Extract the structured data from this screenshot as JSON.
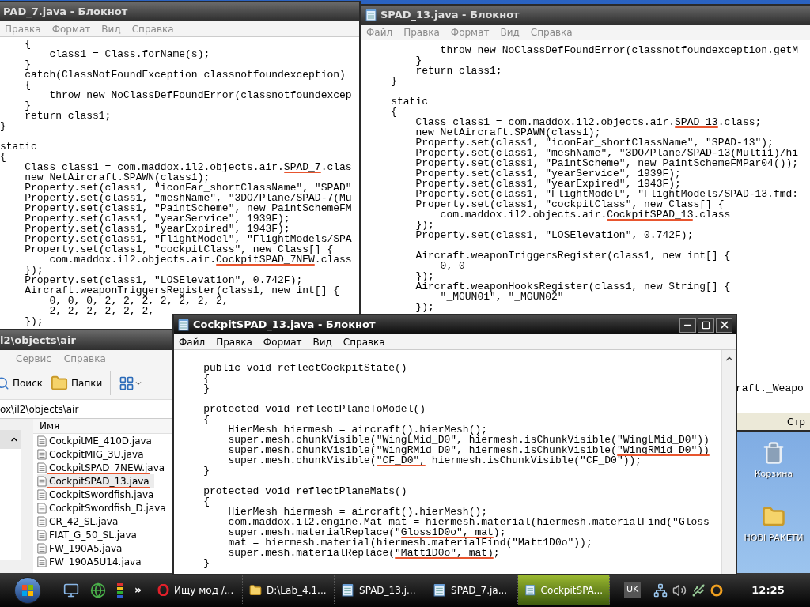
{
  "notepads": [
    {
      "title": "PAD_7.java - Блокнот",
      "active": false,
      "menu": [
        "Правка",
        "Формат",
        "Вид",
        "Справка"
      ],
      "blocks": [
        [
          "    {",
          "        class1 = Class.forName(s);",
          "    }",
          "    catch(ClassNotFoundException classnotfoundexception)",
          "    {",
          "        throw new NoClassDefFoundError(classnotfoundexcep",
          "    }",
          "    return class1;",
          "}"
        ],
        [
          "static",
          "{",
          {
            "parts": [
              {
                "text": "    Class class1 = com.maddox.il2.objects.air.",
                "underlined": false
              },
              {
                "text": "SPAD_7",
                "underlined": true
              },
              {
                "text": ".clas",
                "underlined": false
              }
            ]
          },
          "    new NetAircraft.SPAWN(class1);",
          "    Property.set(class1, \"iconFar_shortClassName\", \"SPAD\"",
          "    Property.set(class1, \"meshName\", \"3DO/Plane/SPAD-7(Mu",
          "    Property.set(class1, \"PaintScheme\", new PaintSchemeFM",
          "    Property.set(class1, \"yearService\", 1939F);",
          "    Property.set(class1, \"yearExpired\", 1943F);",
          "    Property.set(class1, \"FlightModel\", \"FlightModels/SPA",
          "    Property.set(class1, \"cockpitClass\", new Class[] {",
          {
            "parts": [
              {
                "text": "        com.maddox.il2.objects.air.",
                "underlined": false
              },
              {
                "text": "CockpitSPAD_7NEW",
                "underlined": true
              },
              {
                "text": ".class",
                "underlined": false
              }
            ]
          },
          "    });",
          "    Property.set(class1, \"LOSElevation\", 0.742F);",
          "    Aircraft.weaponTriggersRegister(class1, new int[] {",
          "        0, 0, 0, 2, 2, 2, 2, 2, 2, 2,",
          "        2, 2, 2, 2, 2, 2,",
          "    });"
        ]
      ]
    },
    {
      "title": "SPAD_13.java - Блокнот",
      "active": false,
      "menu": [
        "Файл",
        "Правка",
        "Формат",
        "Вид",
        "Справка"
      ],
      "blocks": [
        [
          "            throw new NoClassDefFoundError(classnotfoundexception.getM",
          "        }",
          "        return class1;",
          "    }"
        ],
        [
          "    static",
          "    {",
          {
            "parts": [
              {
                "text": "        Class class1 = com.maddox.il2.objects.air.",
                "underlined": false
              },
              {
                "text": "SPAD_13",
                "underlined": true
              },
              {
                "text": ".class;",
                "underlined": false
              }
            ]
          },
          "        new NetAircraft.SPAWN(class1);",
          "        Property.set(class1, \"iconFar_shortClassName\", \"SPAD-13\");",
          "        Property.set(class1, \"meshName\", \"3DO/Plane/SPAD-13(Multi1)/hi",
          "        Property.set(class1, \"PaintScheme\", new PaintSchemeFMPar04());",
          "        Property.set(class1, \"yearService\", 1939F);",
          "        Property.set(class1, \"yearExpired\", 1943F);",
          "        Property.set(class1, \"FlightModel\", \"FlightModels/SPAD-13.fmd:",
          "        Property.set(class1, \"cockpitClass\", new Class[] {",
          {
            "parts": [
              {
                "text": "            com.maddox.il2.objects.air.",
                "underlined": false
              },
              {
                "text": "CockpitSPAD_13",
                "underlined": true
              },
              {
                "text": ".class",
                "underlined": false
              }
            ]
          },
          "        });",
          "        Property.set(class1, \"LOSElevation\", 0.742F);"
        ],
        [
          "        Aircraft.weaponTriggersRegister(class1, new int[] {",
          "            0, 0",
          "        });",
          "        Aircraft.weaponHooksRegister(class1, new String[] {",
          "            \"_MGUN01\", \"_MGUN02\"",
          "        });"
        ]
      ],
      "fragment": "raft._Weapo",
      "status_text": "Стр"
    },
    {
      "title": "CockpitSPAD_13.java - Блокнот",
      "active": true,
      "window_buttons": true,
      "scrollbar": true,
      "menu": [
        "Файл",
        "Правка",
        "Формат",
        "Вид",
        "Справка"
      ],
      "blocks": [
        [
          "    public void reflectCockpitState()",
          "    {",
          "    }"
        ],
        [
          "    protected void reflectPlaneToModel()",
          "    {",
          "        HierMesh hiermesh = aircraft().hierMesh();",
          "        super.mesh.chunkVisible(\"WingLMid_D0\", hiermesh.isChunkVisible(\"WingLMid_D0\"))",
          {
            "parts": [
              {
                "text": "        super.mesh.chunkVisible(\"WingRMid_D0\", hiermesh.isChunkVisible(",
                "underlined": false
              },
              {
                "text": "\"WingRMid_D0\"))",
                "underlined": true
              }
            ]
          },
          {
            "parts": [
              {
                "text": "        super.mesh.chunkVisible(",
                "underlined": false
              },
              {
                "text": "\"CF_D0\",",
                "underlined": true
              },
              {
                "text": " hiermesh.isChunkVisible(\"CF_D0\"));",
                "underlined": false
              }
            ]
          },
          "    }"
        ],
        [
          "    protected void reflectPlaneMats()",
          "    {",
          "        HierMesh hiermesh = aircraft().hierMesh();",
          "        com.maddox.il2.engine.Mat mat = hiermesh.material(hiermesh.materialFind(\"Gloss",
          {
            "parts": [
              {
                "text": "        super.mesh.materialReplace(\"",
                "underlined": false
              },
              {
                "text": "Gloss1D0o\", mat",
                "underlined": true
              },
              {
                "text": ");",
                "underlined": false
              }
            ]
          },
          "        mat = hiermesh.material(hiermesh.materialFind(\"Matt1D0o\"));",
          {
            "parts": [
              {
                "text": "        super.mesh.materialReplace(",
                "underlined": false
              },
              {
                "text": "\"Matt1D0o\", mat)",
                "underlined": true
              },
              {
                "text": ";",
                "underlined": false
              }
            ]
          },
          "    }"
        ]
      ]
    }
  ],
  "explorer": {
    "title": "l2\\objects\\air",
    "menu": [
      "Сервис",
      "Справка"
    ],
    "toolbar": [
      "Поиск",
      "Папки"
    ],
    "address": "ox\\il2\\objects\\air",
    "column_header": "Имя",
    "files": [
      {
        "name": "CockpitME_410D.java",
        "selected": false,
        "underlined": false
      },
      {
        "name": "CockpitMIG_3U.java",
        "selected": false,
        "underlined": false
      },
      {
        "name": "CockpitSPAD_7NEW.java",
        "selected": false,
        "underlined": true
      },
      {
        "name": "CockpitSPAD_13.java",
        "selected": true,
        "underlined": true
      },
      {
        "name": "CockpitSwordfish.java",
        "selected": false,
        "underlined": false
      },
      {
        "name": "CockpitSwordfish_D.java",
        "selected": false,
        "underlined": false
      },
      {
        "name": "CR_42_SL.java",
        "selected": false,
        "underlined": false
      },
      {
        "name": "FIAT_G_50_SL.java",
        "selected": false,
        "underlined": false
      },
      {
        "name": "FW_190A5.java",
        "selected": false,
        "underlined": false
      },
      {
        "name": "FW_190A5U14.java",
        "selected": false,
        "underlined": false
      }
    ]
  },
  "desktop_icons": [
    {
      "label": "Корзина",
      "kind": "recycle"
    },
    {
      "label": "НОВІ РАКЕТИ",
      "kind": "folder"
    }
  ],
  "taskbar": {
    "more": "»",
    "tasks": [
      {
        "label": "Ищу мод /...",
        "kind": "browser",
        "selected": false
      },
      {
        "label": "D:\\Lab_4.1...",
        "kind": "folder",
        "selected": false
      },
      {
        "label": "SPAD_13.j...",
        "kind": "notepad",
        "selected": false
      },
      {
        "label": "SPAD_7.ja...",
        "kind": "notepad",
        "selected": false
      },
      {
        "label": "CockpitSPA...",
        "kind": "notepad",
        "selected": true
      }
    ],
    "language": "UK",
    "clock": "12:25"
  }
}
